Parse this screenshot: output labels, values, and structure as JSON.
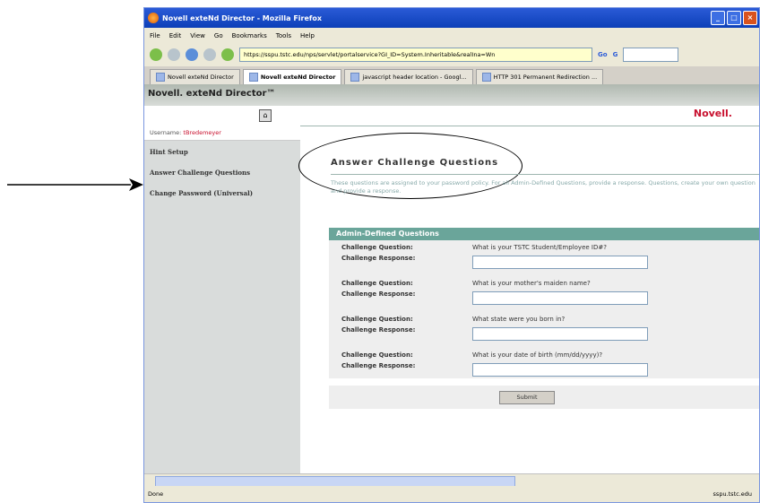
{
  "window": {
    "title": "Novell exteNd Director - Mozilla Firefox",
    "controls": [
      "_",
      "□",
      "×"
    ]
  },
  "menu": [
    "File",
    "Edit",
    "View",
    "Go",
    "Bookmarks",
    "Tools",
    "Help"
  ],
  "nav": {
    "url": "https://sspu.tstc.edu/nps/servlet/portalservice?GI_ID=System.Inheritable&realIna=Wn",
    "go_label": "Go",
    "search_label": "G"
  },
  "tabs": [
    {
      "label": "Novell exteNd Director",
      "active": false
    },
    {
      "label": "Novell exteNd Director",
      "active": true
    },
    {
      "label": "javascript header location - Googl...",
      "active": false
    },
    {
      "label": "HTTP 301 Permanent Redirection ...",
      "active": false
    }
  ],
  "page": {
    "banner": "Novell. exteNd Director™",
    "brand": "Novell.",
    "username_label": "Username:",
    "username": "tBredemeyer",
    "sidebar": [
      {
        "label": "Hint Setup"
      },
      {
        "label": "Answer Challenge Questions"
      },
      {
        "label": "Change Password (Universal)"
      }
    ],
    "heading": "Answer Challenge Questions",
    "intro": "These questions are assigned to your password policy. For all Admin-Defined Questions, provide a response. Questions, create your own question and provide a response.",
    "panel_title": "Admin-Defined Questions",
    "question_label": "Challenge Question:",
    "response_label": "Challenge Response:",
    "questions": [
      {
        "text": "What is your TSTC Student/Employee ID#?",
        "value": ""
      },
      {
        "text": "What is your mother's maiden name?",
        "value": ""
      },
      {
        "text": "What state were you born in?",
        "value": ""
      },
      {
        "text": "What is your date of birth (mm/dd/yyyy)?",
        "value": ""
      }
    ],
    "submit_label": "Submit"
  },
  "status": {
    "left": "Done",
    "right": "sspu.tstc.edu"
  }
}
